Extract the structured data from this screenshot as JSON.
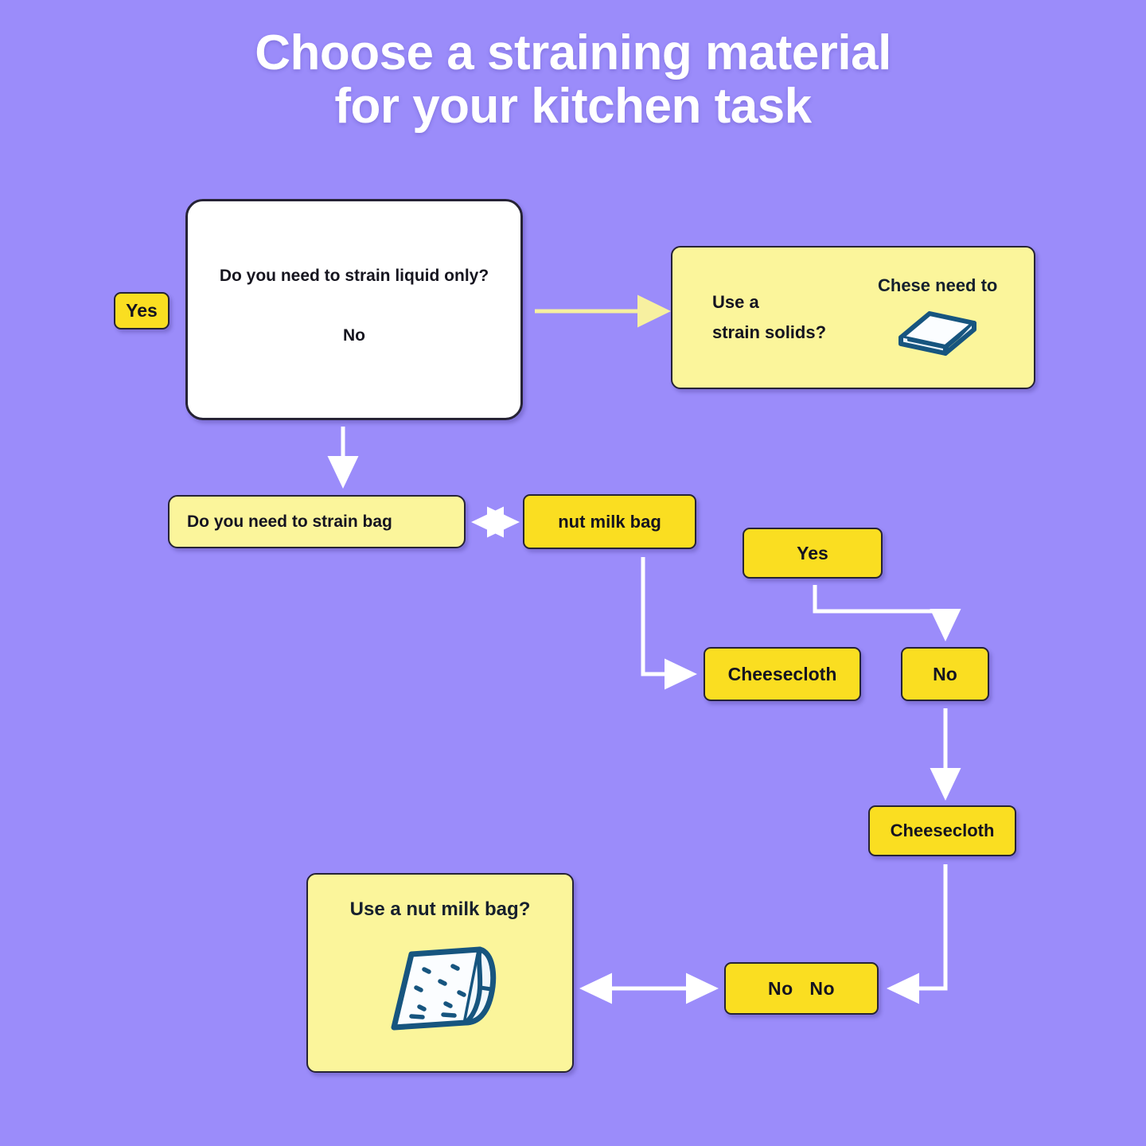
{
  "page": {
    "background_color": "#9b8cfa",
    "title_lines": [
      "Choose a straining material",
      "for your kitchen task"
    ],
    "title_color": "#ffffff"
  },
  "palette": {
    "background": "#9b8cfa",
    "yellow_bright": "#fade21",
    "yellow_pale": "#fbf59b",
    "white": "#ffffff",
    "outline": "#262335",
    "icon_navy": "#17557f",
    "arrow_white": "#ffffff",
    "arrow_pale_yellow": "#f7f0a0"
  },
  "nodes": {
    "yes_chip_left": {
      "label": "Yes",
      "style": "yellow-bright"
    },
    "decision_liquid": {
      "question": "Do you need to strain liquid only?",
      "answer": "No",
      "style": "white"
    },
    "card_solids": {
      "left_line_1": "Use a",
      "left_line_2": "strain solids?",
      "right_text": "Chese need to",
      "icon": "folded-cloth-stack-icon",
      "style": "yellow-pale"
    },
    "box_strain_bag": {
      "label": "Do you need to strain  bag",
      "style": "yellow-pale"
    },
    "chip_nut_milk_bag": {
      "label": "nut milk bag",
      "style": "yellow-bright"
    },
    "chip_yes_2": {
      "label": "Yes",
      "style": "yellow-bright"
    },
    "chip_cheesecloth_1": {
      "label": "Cheesecloth",
      "style": "yellow-bright"
    },
    "chip_no_1": {
      "label": "No",
      "style": "yellow-bright"
    },
    "chip_cheesecloth_2": {
      "label": "Cheesecloth",
      "style": "yellow-bright"
    },
    "chip_no_no": {
      "label": "No   No",
      "style": "yellow-bright"
    },
    "card_nut_milk": {
      "label": "Use a nut milk bag?",
      "icon": "nut-milk-bag-cloth-icon",
      "style": "yellow-pale"
    }
  },
  "connectors": [
    {
      "name": "decision-to-solids-card",
      "from": "decision_liquid",
      "to": "card_solids",
      "kind": "arrow-right",
      "color": "#f7f0a0"
    },
    {
      "name": "decision-to-strain-bag",
      "from": "decision_liquid",
      "to": "box_strain_bag",
      "kind": "arrow-down",
      "color": "#ffffff"
    },
    {
      "name": "strain-bag-to-nut-milk-bag",
      "from": "box_strain_bag",
      "to": "chip_nut_milk_bag",
      "kind": "double-arrow",
      "color": "#ffffff"
    },
    {
      "name": "nut-milk-bag-to-cheesecloth",
      "from": "chip_nut_milk_bag",
      "to": "chip_cheesecloth_1",
      "kind": "elbow-down-right",
      "color": "#ffffff"
    },
    {
      "name": "yes-to-no",
      "from": "chip_yes_2",
      "to": "chip_no_1",
      "kind": "elbow-down-right",
      "color": "#ffffff"
    },
    {
      "name": "no-to-cheesecloth-2",
      "from": "chip_no_1",
      "to": "chip_cheesecloth_2",
      "kind": "arrow-down",
      "color": "#ffffff"
    },
    {
      "name": "cheesecloth-2-to-no-no",
      "from": "chip_cheesecloth_2",
      "to": "chip_no_no",
      "kind": "elbow-down-left",
      "color": "#ffffff"
    },
    {
      "name": "no-no-to-nut-milk-card",
      "from": "chip_no_no",
      "to": "card_nut_milk",
      "kind": "double-arrow",
      "color": "#ffffff"
    }
  ]
}
